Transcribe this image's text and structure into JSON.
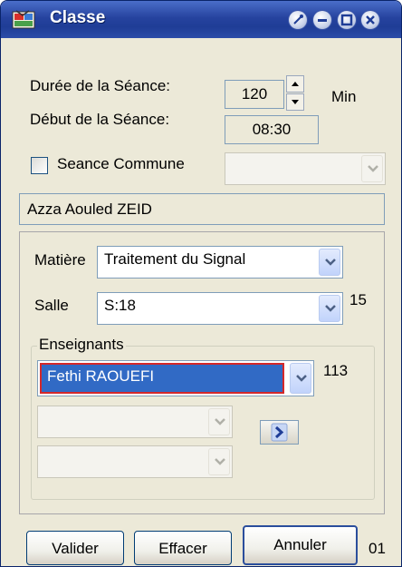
{
  "window": {
    "title": "Classe"
  },
  "duree": {
    "label": "Durée de la Séance:",
    "value": "120",
    "unit": "Min"
  },
  "debut": {
    "label": "Début de la Séance:",
    "value": "08:30"
  },
  "seance_commune": {
    "label": "Seance Commune",
    "checked": false,
    "value": ""
  },
  "class_name": "Azza Aouled ZEID",
  "matiere": {
    "label": "Matière",
    "value": "Traitement du Signal"
  },
  "salle": {
    "label": "Salle",
    "value": "S:18",
    "count": "15"
  },
  "enseignants": {
    "legend": "Enseignants",
    "value": "Fethi RAOUEFI",
    "count": "113",
    "extra1": "",
    "extra2": ""
  },
  "buttons": {
    "valider": "Valider",
    "effacer": "Effacer",
    "annuler": "Annuler",
    "counter": "01"
  }
}
